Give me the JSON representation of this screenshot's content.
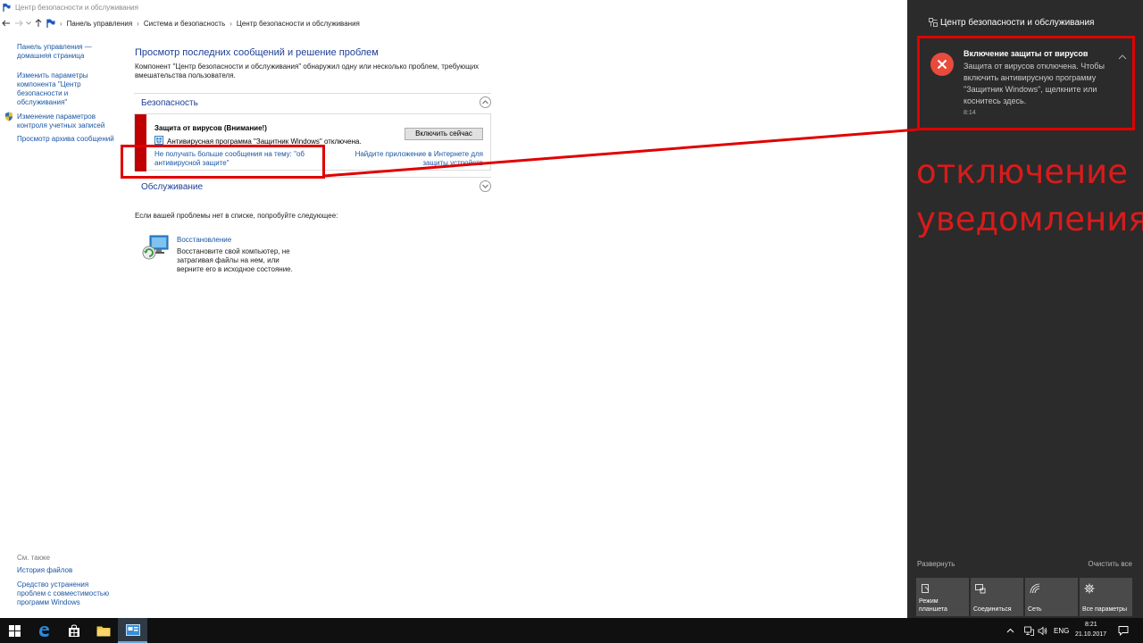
{
  "window": {
    "title": "Центр безопасности и обслуживания"
  },
  "address_bar": {
    "crumbs": [
      "Панель управления",
      "Система и безопасность",
      "Центр безопасности и обслуживания"
    ]
  },
  "left_nav": {
    "home": "Панель управления — домашняя страница",
    "change_settings": "Изменить параметры компонента \"Центр безопасности и обслуживания\"",
    "uac": "Изменение параметров контроля учетных записей",
    "archive": "Просмотр архива сообщений",
    "see_also": "См. также",
    "file_history": "История файлов",
    "compat": "Средство устранения проблем с совместимостью программ Windows"
  },
  "main": {
    "title": "Просмотр последних сообщений и решение проблем",
    "description": "Компонент \"Центр безопасности и обслуживания\" обнаружил одну или несколько проблем, требующих вмешательства пользователя.",
    "security_label": "Безопасность",
    "alert": {
      "title": "Защита от вирусов  (Внимание!)",
      "line": "Антивирусная программа \"Защитник Windows\" отключена.",
      "button": "Включить сейчас",
      "dont_receive": "Не получать больше сообщения на тему: \"об антивирусной защите\"",
      "find_app": "Найдите приложение в Интернете для защиты устройств"
    },
    "maintenance_label": "Обслуживание",
    "try_text": "Если вашей проблемы нет в списке, попробуйте следующее:",
    "restore_link": "Восстановление",
    "restore_desc": "Восстановите свой компьютер, не затрагивая файлы на нем, или верните его в исходное состояние."
  },
  "action_center": {
    "header": "Центр безопасности и обслуживания",
    "toast": {
      "title": "Включение защиты от вирусов",
      "body": "Защита от вирусов отключена. Чтобы включить антивирусную программу \"Защитник Windows\", щелкните или коснитесь здесь.",
      "time": "8:14"
    },
    "expand": "Развернуть",
    "clear_all": "Очистить все",
    "quick_actions": [
      "Режим планшета",
      "Соединиться",
      "Сеть",
      "Все параметры"
    ]
  },
  "annotation": {
    "line1": "отключение",
    "line2": "уведомления",
    "color": "#d81b1b"
  },
  "taskbar": {
    "lang": "ENG",
    "time": "8:21",
    "date": "21.10.2017"
  },
  "colors": {
    "accent_red": "#c00000",
    "link": "#1a56a4",
    "heading": "#1c3f95",
    "action_center_bg": "#2b2b2b",
    "toast_error": "#e84b3c"
  }
}
